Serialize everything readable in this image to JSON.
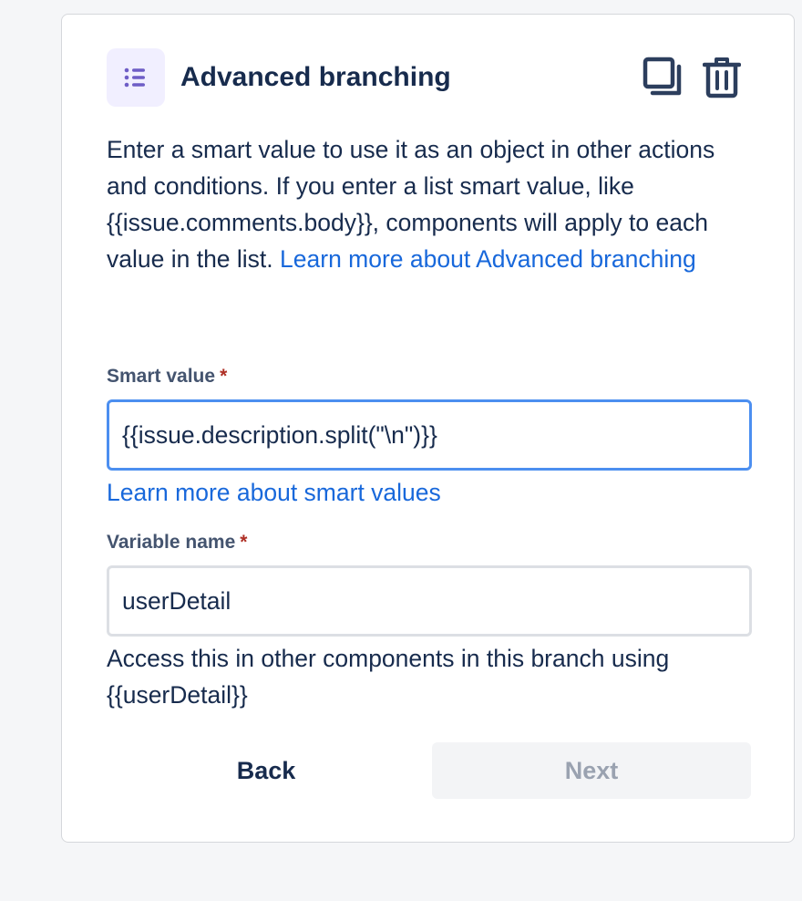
{
  "panel": {
    "title": "Advanced branching",
    "type_icon": "list-icon",
    "actions": {
      "duplicate_icon": "duplicate-icon",
      "delete_icon": "trash-icon"
    }
  },
  "description": {
    "text": "Enter a smart value to use it as an object in other actions and conditions. If you enter a list smart value, like {{issue.comments.body}}, components will apply to each value in the list. ",
    "link_text": "Learn more about Advanced branching"
  },
  "smart_value": {
    "label": "Smart value",
    "required_mark": "*",
    "value": "{{issue.description.split(\"\\n\")}}",
    "link_text": "Learn more about smart values"
  },
  "variable_name": {
    "label": "Variable name",
    "required_mark": "*",
    "value": "userDetail",
    "helper_text": "Access this in other components in this branch using {{userDetail}}"
  },
  "buttons": {
    "back_label": "Back",
    "next_label": "Next"
  },
  "colors": {
    "link": "#1868db",
    "focus_border": "#4c8ff0",
    "required": "#ae2e24",
    "icon_purple": "#6e5dc6"
  }
}
